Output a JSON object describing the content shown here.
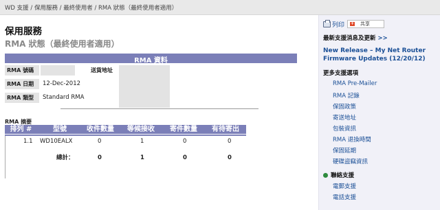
{
  "breadcrumb": {
    "items": [
      "WD 支援",
      "保用服務",
      "最終使用者",
      "RMA 狀態（最終使用者適用）"
    ],
    "separator": " / "
  },
  "page": {
    "title": "保用服務",
    "subtitle": "RMA 狀態（最終使用者適用）"
  },
  "rma_details": {
    "section_title": "RMA 資料",
    "rma_number_label": "RMA 號碼",
    "rma_date_label": "RMA 日期",
    "rma_date_value": "12-Dec-2012",
    "rma_type_label": "RMA 類型",
    "rma_type_value": "Standard RMA",
    "ship_address_label": "送貨地址"
  },
  "summary": {
    "label": "RMA 摘要",
    "columns": [
      "排列 #",
      "型號",
      "收件數量",
      "等候接收",
      "寄件數量",
      "有待寄出"
    ],
    "rows": [
      {
        "line": "1.1",
        "model": "WD10EALX",
        "received": "0",
        "awaiting": "1",
        "shipped": "0",
        "pending": "0"
      }
    ],
    "total_label": "總計：",
    "totals": {
      "received": "0",
      "awaiting": "1",
      "shipped": "0",
      "pending": "0"
    }
  },
  "sidebar": {
    "print_label": "列印",
    "share_label": "共享",
    "latest_title": "最新支援消息及更新",
    "latest_arrows": ">>",
    "news_link": "New Release – My Net Router Firmware Updates (12/20/12)",
    "more_title": "更多支援選項",
    "more_items": [
      "RMA Pre-Mailer",
      "RMA 記錄",
      "保固政策",
      "寄送地址",
      "包裝資訊",
      "RMA 退換時間",
      "保固延期",
      "硬碟盜竊資訊"
    ],
    "contact_title": "聯絡支援",
    "contact_items": [
      "電郵支援",
      "電話支援"
    ]
  },
  "colors": {
    "header_bar": "#7b7fb8",
    "link": "#1a4f96",
    "sidebar_bg": "#f1f1f8",
    "top_bar": "#e9e9e9"
  },
  "icons": [
    "printer-icon",
    "share-icon",
    "contact-support-icon"
  ]
}
